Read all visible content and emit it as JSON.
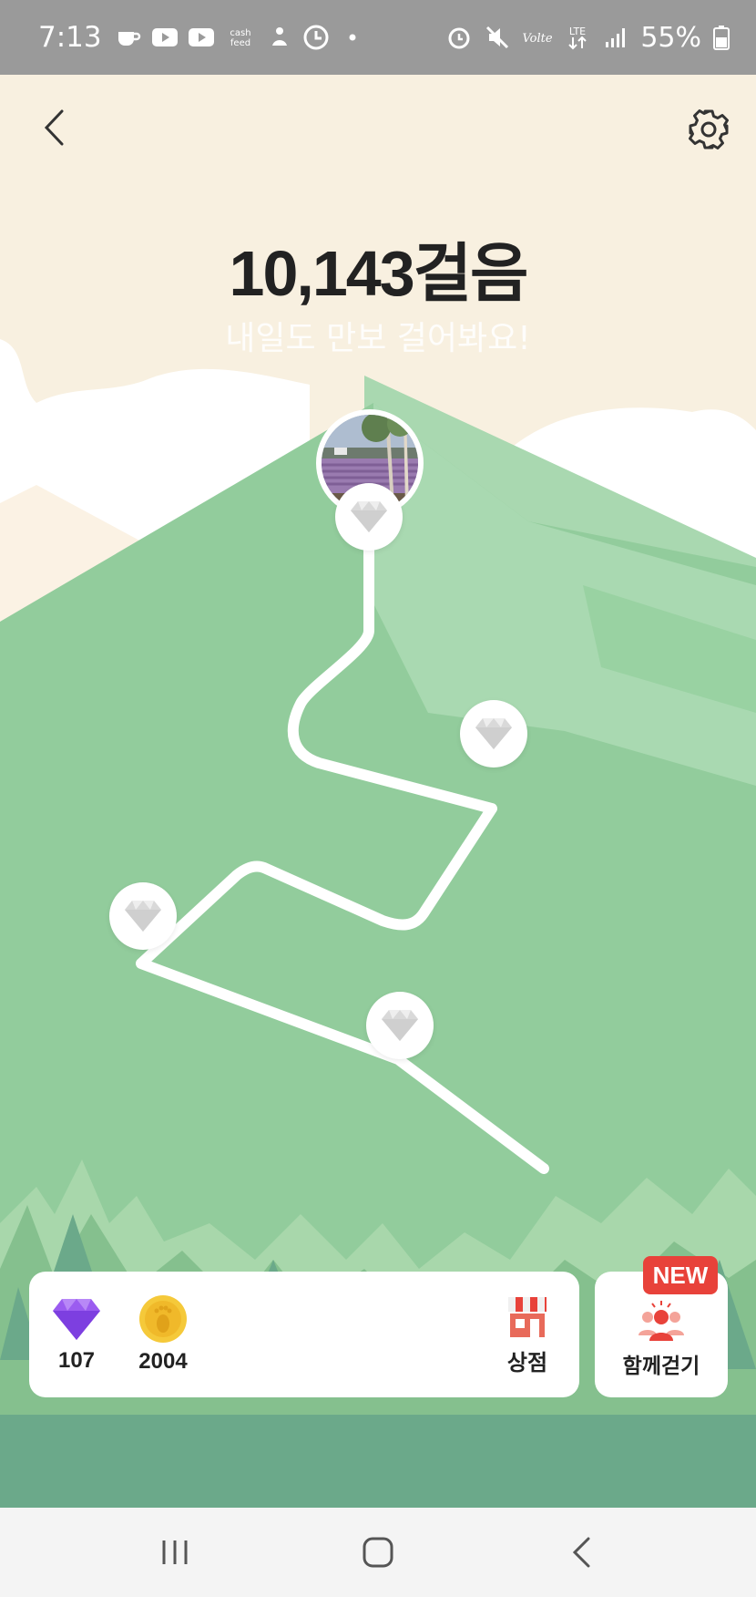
{
  "status_bar": {
    "time": "7:13",
    "battery_text": "55%",
    "icons_left": [
      "coffee-icon",
      "youtube-icon",
      "youtube-icon",
      "cashfeed-icon",
      "meditation-icon",
      "clock-app-icon",
      "dot-icon"
    ],
    "icons_right": [
      "alarm-icon",
      "mute-icon",
      "volte-icon",
      "lte-icon",
      "signal-icon",
      "battery-icon"
    ],
    "cashfeed_label": "cash feed"
  },
  "header": {
    "steps": "10,143걸음",
    "subtitle": "내일도 만보 걸어봐요!"
  },
  "path": {
    "nodes": [
      {
        "type": "photo",
        "name": "lavender field"
      },
      {
        "type": "gem"
      },
      {
        "type": "gem"
      },
      {
        "type": "gem"
      },
      {
        "type": "gem"
      }
    ]
  },
  "bottom": {
    "gems_count": "107",
    "coins_count": "2004",
    "shop_label": "상점",
    "walk_together_label": "함께걷기",
    "new_badge": "NEW"
  },
  "colors": {
    "sky": "#f8f0e0",
    "mountain": "#92cc9c",
    "tree_dark": "#6ba98a",
    "badge": "#e8423a",
    "gem_purple": "#9b5cf0",
    "coin": "#f5c93a"
  }
}
